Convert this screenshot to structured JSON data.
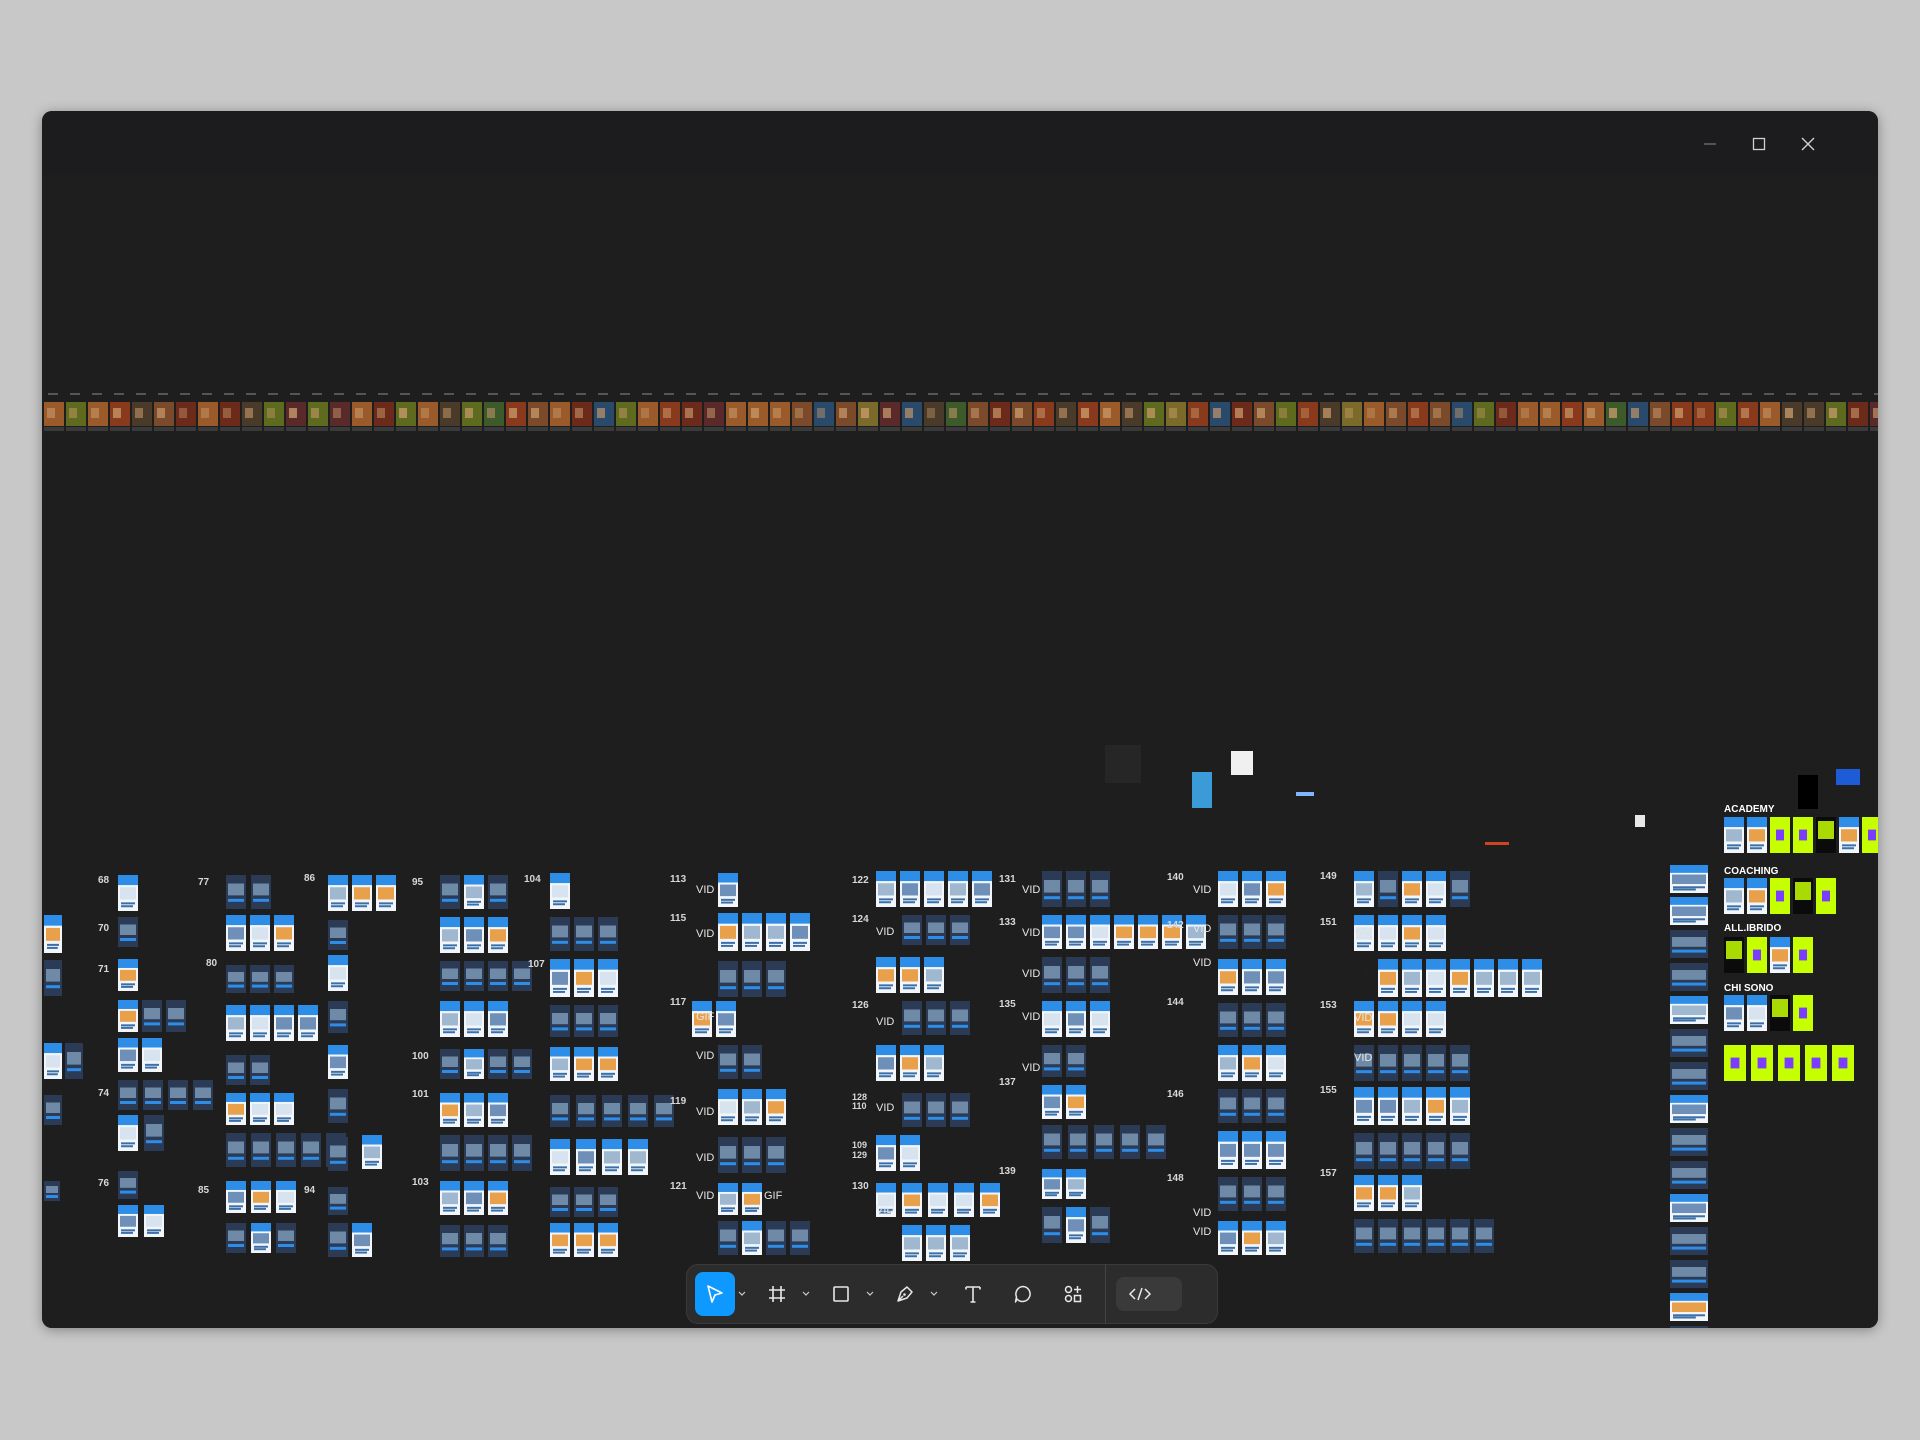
{
  "window": {
    "controls": {
      "minimize_icon": "minimize-icon",
      "maximize_icon": "maximize-icon",
      "close_icon": "close-icon"
    }
  },
  "canvas": {
    "background": "#1e1e1f",
    "accent_blue": "#2e8de6",
    "accent_lime": "#c6ff00",
    "section_labels": {
      "n68": "68",
      "n70": "70",
      "n71": "71",
      "n74": "74",
      "n76": "76",
      "n77": "77",
      "n80": "80",
      "n85": "85",
      "n86": "86",
      "n94": "94",
      "n95": "95",
      "n100": "100",
      "n101": "101",
      "n103": "103",
      "n104": "104",
      "n107": "107",
      "n113": "113",
      "n115": "115",
      "n117": "117",
      "n119": "119",
      "n121": "121",
      "n122": "122",
      "n124": "124",
      "n126": "126",
      "n128": "128",
      "n110": "110",
      "n109": "109",
      "n129": "129",
      "n130": "130",
      "n131": "131",
      "n133": "133",
      "n135": "135",
      "n137": "137",
      "n139": "139",
      "n140": "140",
      "n142": "142",
      "n144": "144",
      "n146": "146",
      "n148": "148",
      "n149": "149",
      "n151": "151",
      "n153": "153",
      "n155": "155",
      "n157": "157"
    },
    "tags": {
      "vid": "VID",
      "gif": "GIF",
      "question": "?"
    },
    "group_labels": {
      "academy": "ACADEMY",
      "coaching": "COACHING",
      "allibrido": "ALL.IBRIDO",
      "chisono": "CHI SONO"
    }
  },
  "toolbar": {
    "tools": [
      {
        "name": "move-tool",
        "icon": "cursor-arrow-icon",
        "active": true
      },
      {
        "name": "frame-tool",
        "icon": "frame-hash-icon",
        "active": false
      },
      {
        "name": "shape-tool",
        "icon": "rectangle-icon",
        "active": false
      },
      {
        "name": "pen-tool",
        "icon": "pen-nib-icon",
        "active": false
      },
      {
        "name": "text-tool",
        "icon": "text-t-icon",
        "active": false
      },
      {
        "name": "comment-tool",
        "icon": "comment-bubble-icon",
        "active": false
      },
      {
        "name": "actions-tool",
        "icon": "components-icon",
        "active": false
      }
    ],
    "dev_mode_icon": "code-brackets-icon",
    "active_color": "#0d99ff"
  }
}
